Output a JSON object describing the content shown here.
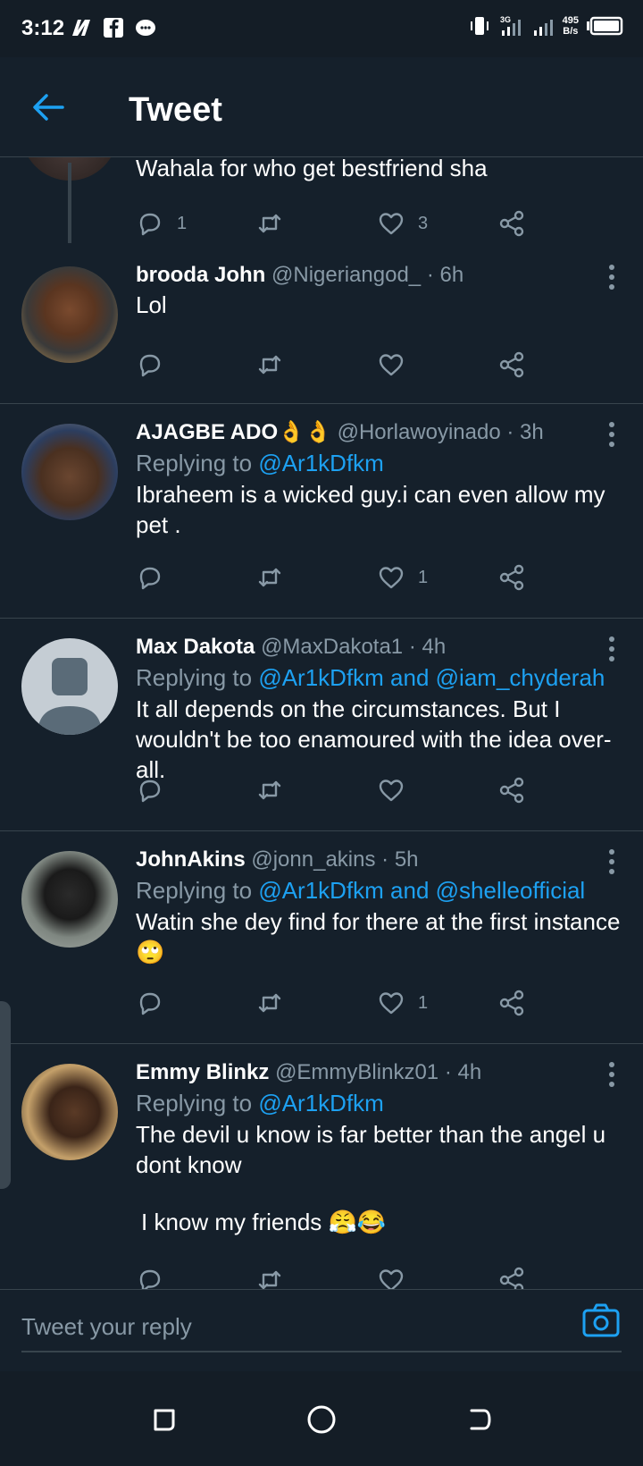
{
  "status_bar": {
    "time": "3:12",
    "net_speed_value": "495",
    "net_speed_unit": "B/s",
    "network": "3G"
  },
  "header": {
    "title": "Tweet"
  },
  "parent_tweet": {
    "text": "Wahala for who get bestfriend sha",
    "reply_count": "1",
    "like_count": "3"
  },
  "tweets": [
    {
      "name": "brooda John",
      "handle": "@Nigeriangod_",
      "time": "· 6h",
      "replying_label": "",
      "mentions": "",
      "text": "Lol",
      "reply_count": "",
      "like_count": ""
    },
    {
      "name": "AJAGBE ADO👌👌",
      "handle": "@Horlawoyinado",
      "time": "· 3h",
      "replying_label": "Replying to",
      "mentions": "@Ar1kDfkm",
      "text": "Ibraheem is a wicked guy.i can even allow my pet .",
      "reply_count": "",
      "like_count": "1"
    },
    {
      "name": "Max Dakota",
      "handle": "@MaxDakota1",
      "time": "· 4h",
      "replying_label": "Replying to",
      "mentions": "@Ar1kDfkm and @iam_chyderah",
      "text": "It all depends on the circumstances. But I wouldn't be too enamoured with the idea over-all.",
      "reply_count": "",
      "like_count": ""
    },
    {
      "name": "JohnAkins",
      "handle": "@jonn_akins",
      "time": "· 5h",
      "replying_label": "Replying to",
      "mentions": "@Ar1kDfkm and @shelleofficial",
      "text": "Watin she dey find for there at the first instance 🙄",
      "reply_count": "",
      "like_count": "1"
    },
    {
      "name": "Emmy Blinkz",
      "handle": "@EmmyBlinkz01",
      "time": "· 4h",
      "replying_label": "Replying to",
      "mentions": "@Ar1kDfkm",
      "text": "The devil u know is far better than the angel u dont know",
      "text2": "I know my friends 😤😂",
      "reply_count": "",
      "like_count": ""
    }
  ],
  "reply_bar": {
    "placeholder": "Tweet your reply"
  },
  "colors": {
    "background": "#15202b",
    "accent": "#1da1f2",
    "muted": "#8899a6",
    "divider": "#38444d"
  }
}
